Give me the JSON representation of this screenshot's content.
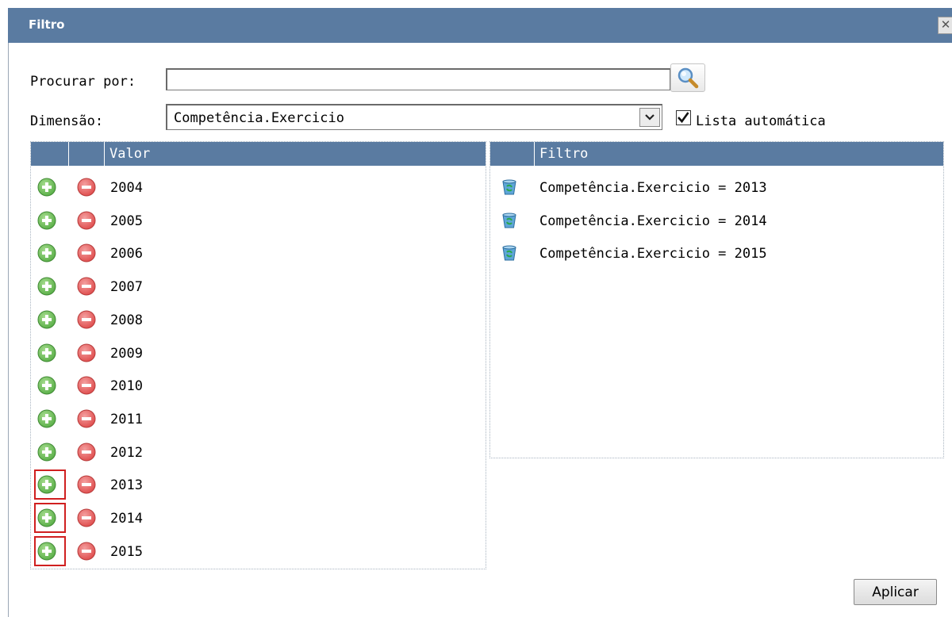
{
  "window": {
    "title": "Filtro",
    "close_glyph": "✕"
  },
  "search": {
    "label": "Procurar por:",
    "value": "",
    "placeholder": ""
  },
  "dimension": {
    "label": "Dimensão:",
    "selected": "Competência.Exercicio"
  },
  "auto_list": {
    "label": "Lista automática",
    "checked": true
  },
  "values_grid": {
    "columns": [
      "",
      "",
      "Valor"
    ],
    "rows": [
      {
        "value": "2004",
        "highlighted": false
      },
      {
        "value": "2005",
        "highlighted": false
      },
      {
        "value": "2006",
        "highlighted": false
      },
      {
        "value": "2007",
        "highlighted": false
      },
      {
        "value": "2008",
        "highlighted": false
      },
      {
        "value": "2009",
        "highlighted": false
      },
      {
        "value": "2010",
        "highlighted": false
      },
      {
        "value": "2011",
        "highlighted": false
      },
      {
        "value": "2012",
        "highlighted": false
      },
      {
        "value": "2013",
        "highlighted": true
      },
      {
        "value": "2014",
        "highlighted": true
      },
      {
        "value": "2015",
        "highlighted": true
      }
    ]
  },
  "filter_grid": {
    "columns": [
      "",
      "Filtro"
    ],
    "rows": [
      {
        "text": "Competência.Exercicio = 2013"
      },
      {
        "text": "Competência.Exercicio = 2014"
      },
      {
        "text": "Competência.Exercicio = 2015"
      }
    ]
  },
  "apply_button": {
    "label": "Aplicar"
  },
  "colors": {
    "header": "#5a7ba1",
    "add": "#5cb04a",
    "remove": "#e05050",
    "highlight": "#d02020"
  },
  "icons": {
    "search": "magnifier-icon",
    "add": "plus-circle-icon",
    "remove": "minus-circle-icon",
    "delete_filter": "recycle-bin-icon"
  }
}
